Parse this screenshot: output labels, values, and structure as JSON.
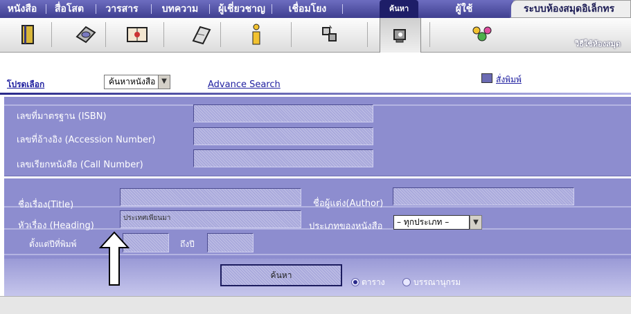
{
  "nav": {
    "items": [
      "หนังสือ",
      "สื่อโสต",
      "วารสาร",
      "บทความ",
      "ผู้เชี่ยวชาญ",
      "เชื่อมโยง",
      "ค้นหา",
      "ผู้ใช้"
    ],
    "active": "ค้นหา",
    "system_title": "ระบบห้องสมุดอิเล็กทร"
  },
  "toolbar": {
    "icons": [
      "book-icon",
      "media-disc-icon",
      "journal-icon",
      "article-icon",
      "info-icon",
      "links-icon",
      "search-tool-icon",
      "users-icon"
    ],
    "help_link": "วิธีใช้ห้องสมุด"
  },
  "selection": {
    "label": "โปรดเลือก",
    "dropdown_value": "ค้นหาหนังสือ",
    "advance_search": "Advance Search",
    "print_label": "สั่งพิมพ์"
  },
  "panel1": {
    "isbn_label": "เลขที่มาตรฐาน (ISBN)",
    "accession_label": "เลขที่อ้างอิง (Accession Number)",
    "call_label": "เลขเรียกหนังสือ (Call Number)"
  },
  "panel2": {
    "title_label": "ชื่อเรื่อง(Title)",
    "author_label": "ชื่อผู้แต่ง(Author)",
    "heading_label": "หัวเรื่อง (Heading)",
    "heading_value": "ประเทศเพียนมา",
    "type_label": "ประเภทของหนังสือ",
    "type_value": "– ทุกประเภท –",
    "year_from_label": "ตั้งแต่ปีที่พิมพ์",
    "year_to_label": "ถึงปี",
    "search_button": "ค้นหา",
    "radio_table": "ตาราง",
    "radio_bib": "บรรณานุกรม"
  },
  "colors": {
    "nav_bg": "#2a2a7a",
    "panel_bg": "#8d8dcf",
    "accent": "#2020a0"
  }
}
